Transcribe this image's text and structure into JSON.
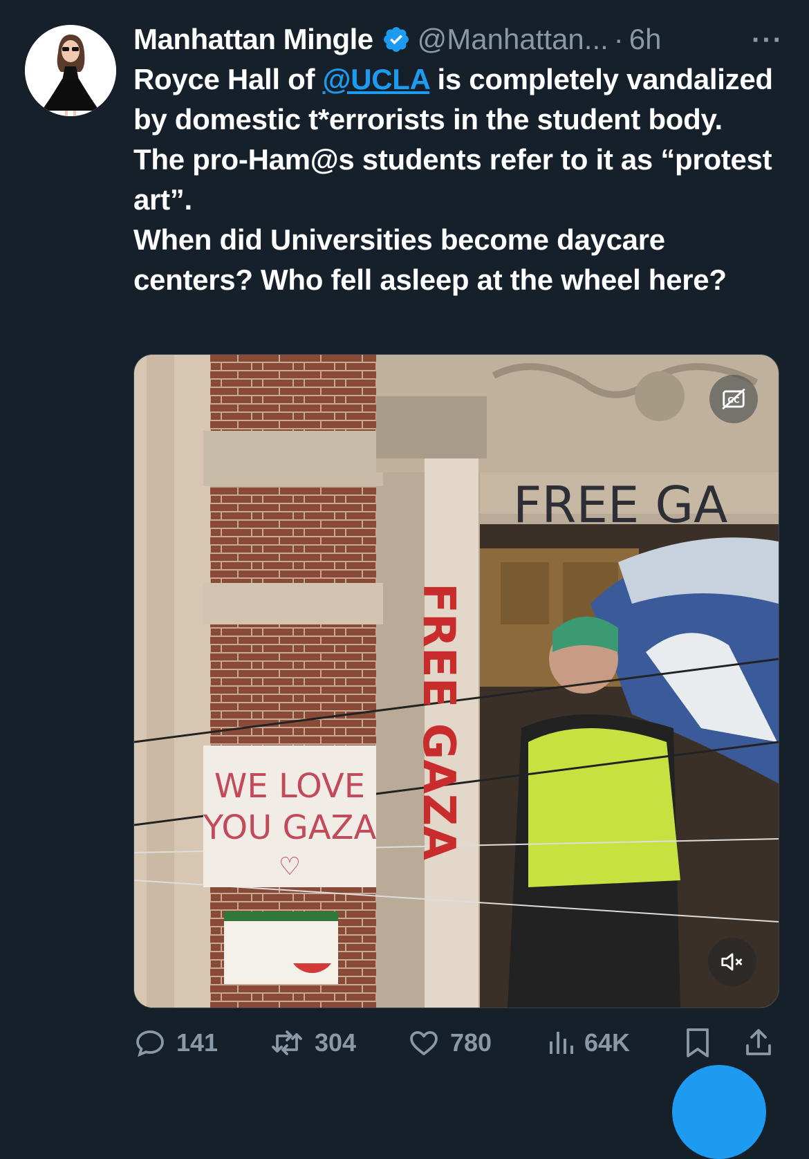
{
  "author": {
    "name": "Manhattan Mingle",
    "handle": "@Manhattan...",
    "separator": "·",
    "time": "6h"
  },
  "more_label": "···",
  "tweet": {
    "part1": "Royce Hall of ",
    "mention": "@UCLA",
    "part2": " is completely vandalized by domestic t*errorists in the student body.\nThe pro-Ham@s students refer to it as “protest art”.\nWhen did Universities become daycare centers? Who fell asleep at the wheel here?"
  },
  "media": {
    "graffiti_text": "FREE GA",
    "column_text": "FREE GAZA",
    "sign_text_line1": "WE LOVE",
    "sign_text_line2": "YOU GAZA",
    "captions_icon": "closed-captions-off-icon",
    "mute_icon": "muted-speaker-icon"
  },
  "actions": {
    "replies": "141",
    "reposts": "304",
    "likes": "780",
    "views": "64K"
  },
  "colors": {
    "background": "#15202b",
    "accent": "#1d9bf0",
    "muted": "#8b98a5"
  }
}
